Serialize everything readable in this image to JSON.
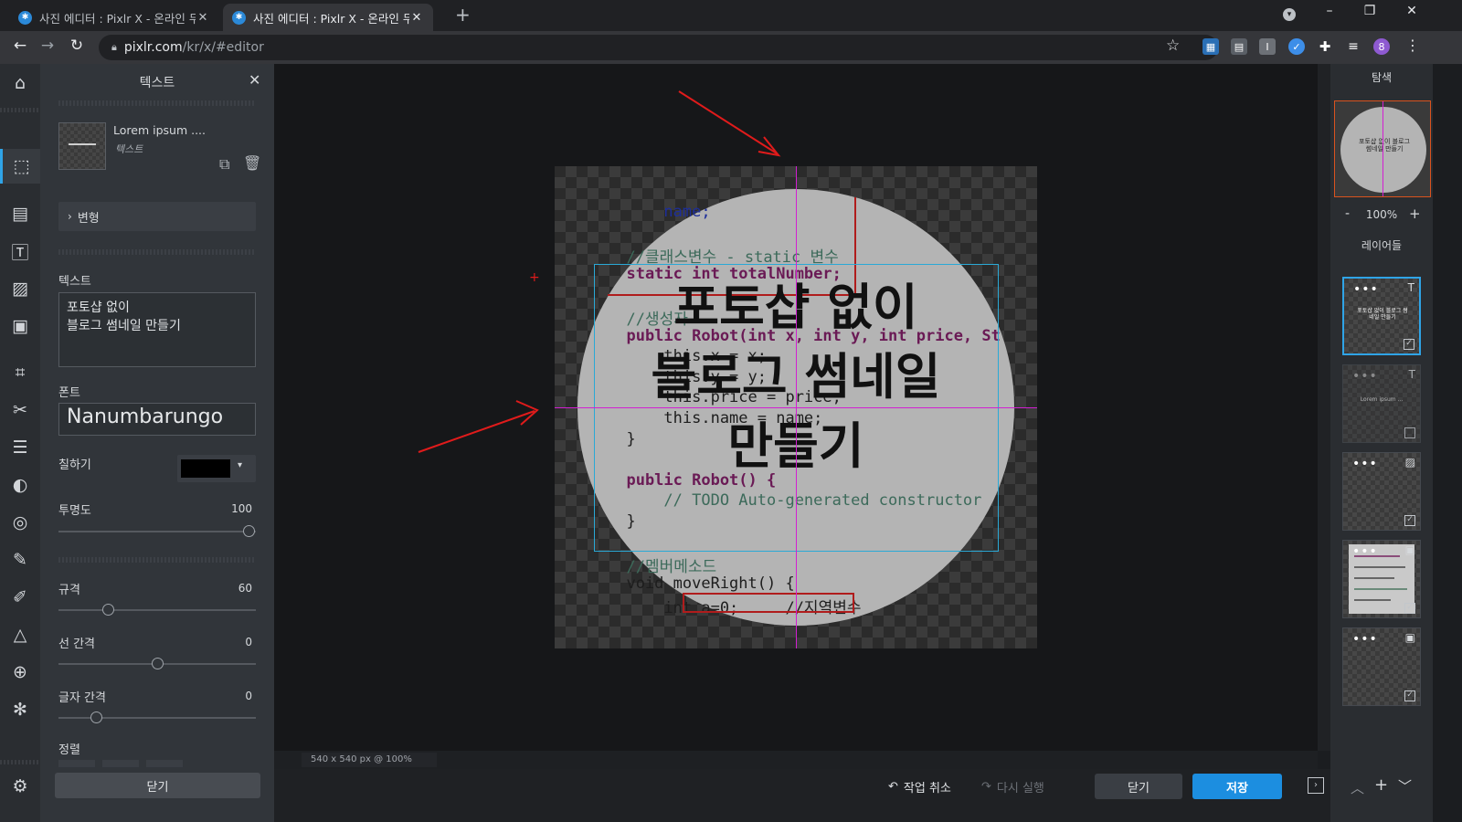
{
  "browser": {
    "tabs": [
      {
        "title": "사진 에디터 : Pixlr X - 온라인 무",
        "active": false
      },
      {
        "title": "사진 에디터 : Pixlr X - 온라인 무",
        "active": true
      }
    ],
    "url_host": "pixlr.com",
    "url_path": "/kr/x/#editor",
    "profile_initial": "8"
  },
  "panel": {
    "title": "텍스트",
    "layer_name": "Lorem ipsum ....",
    "layer_type": "텍스트",
    "transform_label": "변형",
    "text_label": "텍스트",
    "text_value": "포토샵 없이\n블로그 썸네일 만들기",
    "font_label": "폰트",
    "font_value": "Nanumbarungo",
    "fill_label": "칠하기",
    "fill_color": "#000000",
    "opacity_label": "투명도",
    "opacity_value": "100",
    "size_label": "규격",
    "size_value": "60",
    "line_spacing_label": "선 간격",
    "line_spacing_value": "0",
    "letter_spacing_label": "글자 간격",
    "letter_spacing_value": "0",
    "align_label": "정렬",
    "close_label": "닫기"
  },
  "canvas": {
    "code_lines": [
      {
        "t": "      name;",
        "c": "fd"
      },
      {
        "t": "",
        "c": ""
      },
      {
        "t": "  //클래스변수 - static 변수",
        "c": "cm"
      },
      {
        "t": "  static int totalNumber;",
        "c": "kw"
      },
      {
        "t": "",
        "c": ""
      },
      {
        "t": "  //생성자",
        "c": "cm"
      },
      {
        "t": "  public Robot(int x, int y, int price, St",
        "c": "kw"
      },
      {
        "t": "      this.x = x;",
        "c": ""
      },
      {
        "t": "      this.y = y;",
        "c": ""
      },
      {
        "t": "      this.price = price;",
        "c": ""
      },
      {
        "t": "      this.name = name;",
        "c": ""
      },
      {
        "t": "  }",
        "c": ""
      },
      {
        "t": "",
        "c": ""
      },
      {
        "t": "  public Robot() {",
        "c": "kw"
      },
      {
        "t": "      // TODO Auto-generated constructor",
        "c": "cm"
      },
      {
        "t": "  }",
        "c": ""
      },
      {
        "t": "",
        "c": ""
      },
      {
        "t": "  //멤버메소드",
        "c": "cm"
      },
      {
        "t": "  void moveRight() {",
        "c": ""
      },
      {
        "t": "      int a=0;     //지역변수",
        "c": ""
      }
    ],
    "headline_lines": [
      "포토샵 없이",
      "블로그 썸네일",
      "만들기"
    ],
    "status": "540 x 540 px @ 100%"
  },
  "bottom": {
    "undo_label": "작업 취소",
    "redo_label": "다시 실행",
    "close_label": "닫기",
    "save_label": "저장"
  },
  "right": {
    "navigator_title": "탐색",
    "zoom_minus": "-",
    "zoom_value": "100%",
    "zoom_plus": "+",
    "layers_title": "레이어들",
    "layer_preview_text_1": "포토샵 없이 블로그 썸네일 만들기",
    "layer_preview_text_2": "Lorem ipsum ..."
  },
  "colors": {
    "accent": "#2fa4e7",
    "save_button": "#1c8ee0",
    "guide": "#d21fd2",
    "selection": "#2aa9d6",
    "annotation_red": "#e01b1b"
  }
}
